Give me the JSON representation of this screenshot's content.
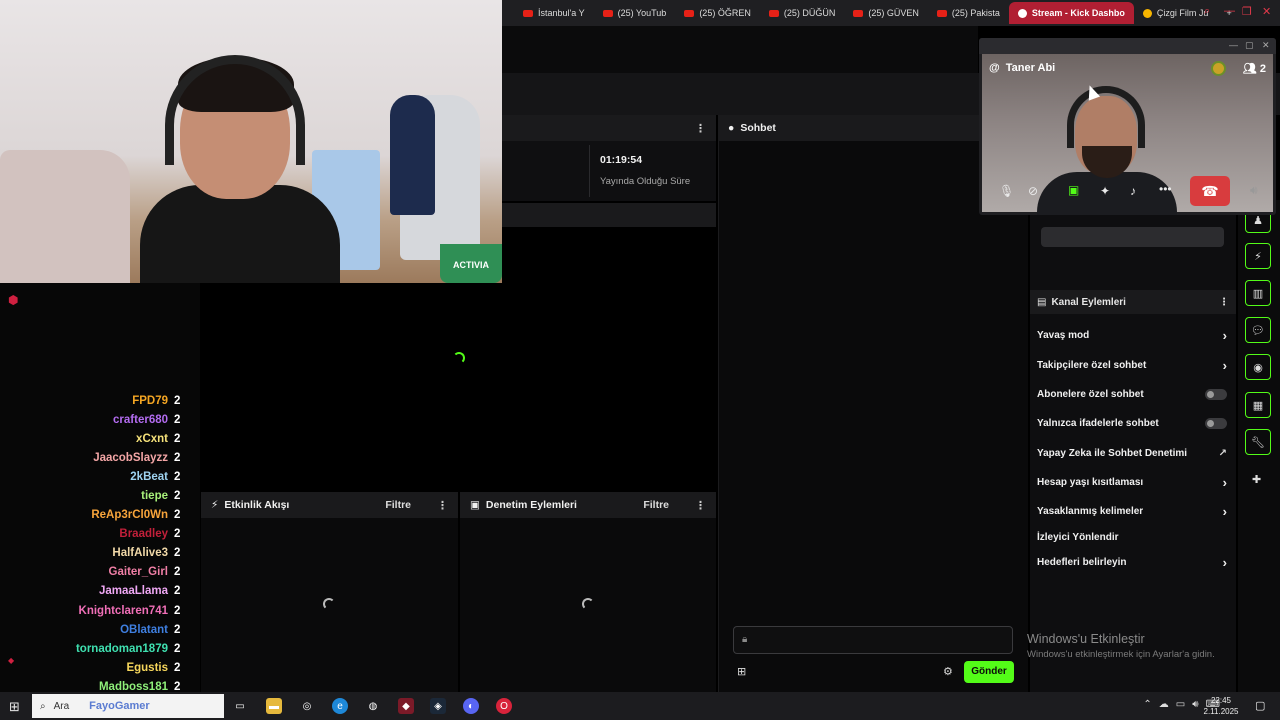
{
  "browser": {
    "tabs": [
      {
        "label": "İstanbul'a Y",
        "active": false
      },
      {
        "label": "(25) YouTub",
        "active": false
      },
      {
        "label": "(25) ÖĞREN",
        "active": false
      },
      {
        "label": "(25) DÜĞÜN",
        "active": false
      },
      {
        "label": "(25) GÜVEN",
        "active": false
      },
      {
        "label": "(25) Pakista",
        "active": false
      },
      {
        "label": "Stream - Kick Dashbo",
        "active": true
      },
      {
        "label": "Çizgi Film Ju",
        "active": false
      }
    ],
    "new_tab": "+"
  },
  "webcam": {
    "cup_text": "ACTIVIA"
  },
  "stats": {
    "stream_time": "01:19:54",
    "stream_time_label": "Yayında Olduğu Süre"
  },
  "panels": {
    "activity_feed": {
      "title": "Etkinlik Akışı",
      "filter": "Filtre"
    },
    "moderation": {
      "title": "Denetim Eylemleri",
      "filter": "Filtre"
    },
    "chat": {
      "title": "Sohbet",
      "send": "Gönder"
    }
  },
  "leaderboard": [
    {
      "name": "FPD79",
      "count": "2",
      "color": "#f5a623"
    },
    {
      "name": "crafter680",
      "count": "2",
      "color": "#b36cf0"
    },
    {
      "name": "xCxnt",
      "count": "2",
      "color": "#f6e27a"
    },
    {
      "name": "JaacobSlayzz",
      "count": "2",
      "color": "#f4a6a6"
    },
    {
      "name": "2kBeat",
      "count": "2",
      "color": "#9fd3f0"
    },
    {
      "name": "tiepe",
      "count": "2",
      "color": "#a8f07a"
    },
    {
      "name": "ReAp3rCl0Wn",
      "count": "2",
      "color": "#f7a43b"
    },
    {
      "name": "Braadley",
      "count": "2",
      "color": "#c2203a"
    },
    {
      "name": "HalfAlive3",
      "count": "2",
      "color": "#f1d9a8"
    },
    {
      "name": "Gaiter_Girl",
      "count": "2",
      "color": "#f07fa6"
    },
    {
      "name": "JamaaLlama",
      "count": "2",
      "color": "#f0a8f5"
    },
    {
      "name": "Knightclaren741",
      "count": "2",
      "color": "#f06fb7"
    },
    {
      "name": "OBlatant",
      "count": "2",
      "color": "#3f7fe0"
    },
    {
      "name": "tornadoman1879",
      "count": "2",
      "color": "#3fe0b0"
    },
    {
      "name": "Egustis",
      "count": "2",
      "color": "#f7d75c"
    },
    {
      "name": "Madboss181",
      "count": "2",
      "color": "#8ff07a"
    }
  ],
  "channel_actions": {
    "title": "Kanal Eylemleri",
    "items": [
      {
        "label": "Yavaş mod",
        "control": "chevron"
      },
      {
        "label": "Takipçilere özel sohbet",
        "control": "chevron"
      },
      {
        "label": "Abonelere özel sohbet",
        "control": "toggle",
        "on": false
      },
      {
        "label": "Yalnızca ifadelerle sohbet",
        "control": "toggle",
        "on": false
      },
      {
        "label": "Yapay Zeka ile Sohbet Denetimi",
        "control": "external"
      },
      {
        "label": "Hesap yaşı kısıtlaması",
        "control": "chevron"
      },
      {
        "label": "Yasaklanmış kelimeler",
        "control": "chevron"
      },
      {
        "label": "İzleyici Yönlendir",
        "control": "none"
      },
      {
        "label": "Hedefleri belirleyin",
        "control": "chevron"
      }
    ]
  },
  "call": {
    "user": "Taner Abi",
    "participants": "2"
  },
  "watermark": {
    "title": "Windows'u Etkinleştir",
    "subtitle": "Windows'u etkinleştirmek için Ayarlar'a gidin."
  },
  "taskbar": {
    "search_placeholder": "Ara",
    "search_brand": "FayoGamer",
    "time": "22:45",
    "date": "2.11.2025"
  },
  "colors": {
    "accent": "#53fc18",
    "kick_red": "#d02040",
    "hangup": "#d83c3e"
  }
}
